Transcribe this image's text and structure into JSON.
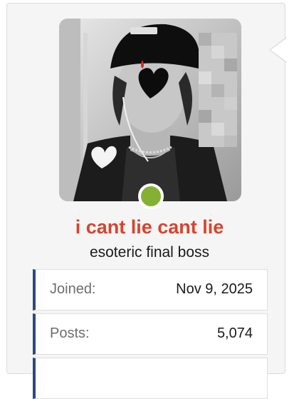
{
  "user": {
    "username": "i cant lie cant lie",
    "title": "esoteric final boss",
    "status_color": "#84b132",
    "name_color": "#d9432d"
  },
  "stats": [
    {
      "label": "Joined:",
      "value": "Nov 9, 2025"
    },
    {
      "label": "Posts:",
      "value": "5,074"
    },
    {
      "label": "",
      "value": ""
    }
  ],
  "colors": {
    "accent_bar": "#2c4a82",
    "panel_bg": "#f5f5f5"
  },
  "icons": [
    "pixelated-blur-overlay",
    "heart-sticker",
    "blood-drop-sticker",
    "white-heart-sticker"
  ]
}
